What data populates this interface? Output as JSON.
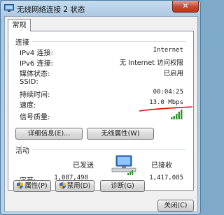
{
  "window": {
    "title": "无线网络连接 2 状态",
    "close_glyph": "✕"
  },
  "tab": {
    "label": "常规"
  },
  "connection": {
    "group_label": "连接",
    "rows": [
      {
        "label": "IPv4 连接:",
        "value": "Internet"
      },
      {
        "label": "IPv6 连接:",
        "value": "无 Internet 访问权限"
      },
      {
        "label": "媒体状态:",
        "value": "已启用"
      },
      {
        "label": "SSID:",
        "value": ""
      },
      {
        "label": "持续时间:",
        "value": "00:04:25"
      },
      {
        "label": "速度:",
        "value": "13.0 Mbps"
      }
    ],
    "signal_label": "信号质量:",
    "signal_level": 5,
    "signal_max": 5,
    "details_button": "详细信息(E)...",
    "wireless_props_button": "无线属性(W)"
  },
  "activity": {
    "group_label": "活动",
    "sent_label": "已发送",
    "recv_label": "已接收",
    "bytes_label": "字节:",
    "bytes_sent": "1,087,498",
    "bytes_recv": "1,417,085"
  },
  "buttons": {
    "properties": "属性(P)",
    "disable": "禁用(D)",
    "diagnose": "诊断(G)",
    "close": "关闭(C)"
  },
  "colors": {
    "signal_green": "#2e9a2e",
    "annotation_red": "#e01010"
  },
  "icons": {
    "title": "network-status-icon",
    "shield": "uac-shield-icon",
    "network": "network-computers-icon"
  }
}
